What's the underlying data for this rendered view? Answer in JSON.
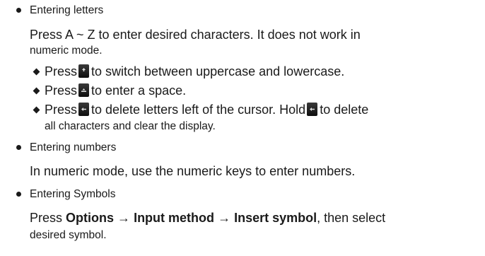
{
  "items": [
    {
      "heading": "Entering letters",
      "desc_line1": "Press A ~ Z to enter desired characters. It does not work in",
      "desc_line2": "numeric mode.",
      "subitems": [
        {
          "pre": "Press",
          "post": "to switch between uppercase and lowercase.",
          "key_icon": "shift-key-icon"
        },
        {
          "pre": "Press",
          "post": "to enter a space.",
          "key_icon": "space-key-icon"
        },
        {
          "pre": "Press",
          "mid": "to delete letters left of the cursor. Hold",
          "post": "to delete",
          "line2": "all characters and clear the display.",
          "key_icon": "backspace-key-icon"
        }
      ]
    },
    {
      "heading": "Entering numbers",
      "desc": "In numeric mode, use the numeric keys to enter numbers."
    },
    {
      "heading": "Entering Symbols",
      "desc_pre": "Press",
      "options": "Options",
      "arrow": "→",
      "input_method": "Input method",
      "insert_symbol": "Insert symbol",
      "desc_post": ", then select",
      "desc_line2": "desired symbol."
    }
  ]
}
